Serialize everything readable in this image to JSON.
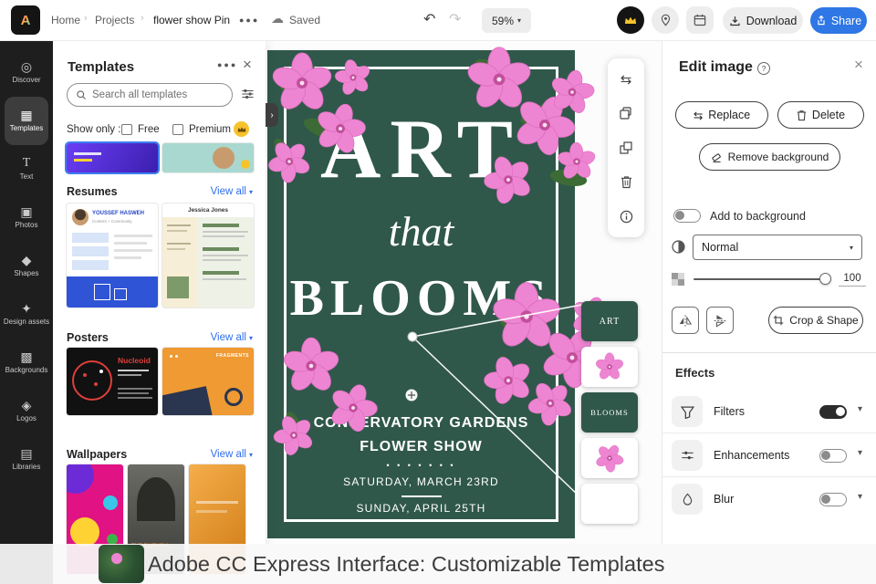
{
  "topbar": {
    "breadcrumb": {
      "home": "Home",
      "projects": "Projects",
      "current": "flower show Pin"
    },
    "saved_label": "Saved",
    "zoom_value": "59%",
    "download_label": "Download",
    "share_label": "Share"
  },
  "sidebar": {
    "items": [
      {
        "label": "Discover"
      },
      {
        "label": "Templates"
      },
      {
        "label": "Text"
      },
      {
        "label": "Photos"
      },
      {
        "label": "Shapes"
      },
      {
        "label": "Design assets"
      },
      {
        "label": "Backgrounds"
      },
      {
        "label": "Logos"
      },
      {
        "label": "Libraries"
      }
    ]
  },
  "templates_panel": {
    "title": "Templates",
    "search_placeholder": "Search all templates",
    "show_only_label": "Show only :",
    "free_label": "Free",
    "premium_label": "Premium",
    "sections": {
      "resumes": {
        "title": "Resumes",
        "view_all": "View all"
      },
      "posters": {
        "title": "Posters",
        "view_all": "View all"
      },
      "wallpapers": {
        "title": "Wallpapers",
        "view_all": "View all"
      }
    },
    "cards": {
      "resume1_name": "YOUSSEF HASWEH",
      "resume1_subtitle": "Content + Community",
      "resume2_name": "Jessica Jones",
      "poster1_name": "Nucleoid",
      "poster2_name": "FRAGMENTS",
      "wallpaper2_name": "THE FAITHFUL"
    }
  },
  "canvas": {
    "design": {
      "title_line1": "ART",
      "title_line2": "that",
      "title_line3": "BLOOMS",
      "venue_line1": "CONSERVATORY GARDENS",
      "venue_line2": "FLOWER SHOW",
      "dots": "• • • • • • •",
      "date_line1": "SATURDAY, MARCH 23RD",
      "date_line2": "SUNDAY, APRIL 25TH"
    },
    "layers": {
      "art_label": "ART",
      "blooms_label": "BLOOMS"
    }
  },
  "edit_panel": {
    "title": "Edit image",
    "replace_label": "Replace",
    "delete_label": "Delete",
    "remove_background_label": "Remove background",
    "add_to_background_label": "Add to background",
    "blend_mode_value": "Normal",
    "opacity_value": "100",
    "crop_shape_label": "Crop & Shape",
    "effects_title": "Effects",
    "effects": [
      {
        "label": "Filters",
        "on": true
      },
      {
        "label": "Enhancements",
        "on": false
      },
      {
        "label": "Blur",
        "on": false
      }
    ]
  },
  "caption": "Adobe CC Express  Interface: Customizable Templates",
  "colors": {
    "accent_blue": "#2e77e5",
    "premium_yellow": "#f6c32c",
    "pin_green": "#30584a",
    "flower_pink": "#ee85d2"
  }
}
